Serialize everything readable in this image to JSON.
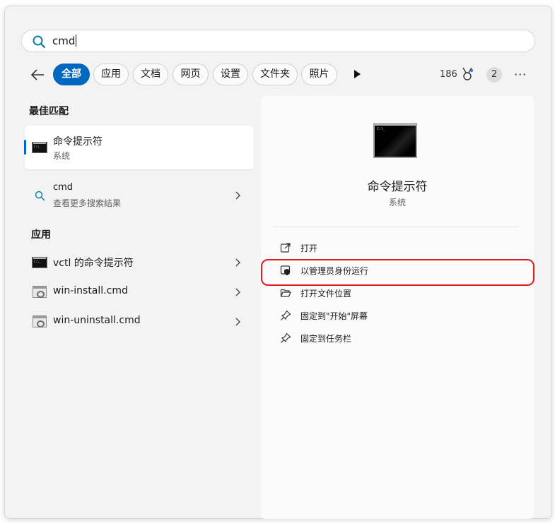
{
  "search": {
    "query": "cmd"
  },
  "filters": [
    {
      "label": "全部",
      "active": true
    },
    {
      "label": "应用"
    },
    {
      "label": "文档"
    },
    {
      "label": "网页"
    },
    {
      "label": "设置"
    },
    {
      "label": "文件夹"
    },
    {
      "label": "照片"
    }
  ],
  "header_right": {
    "points": "186",
    "avatar_letter": "2",
    "more": "···"
  },
  "best_match": {
    "section_title": "最佳匹配",
    "title": "命令提示符",
    "subtitle": "系统"
  },
  "web_search": {
    "title": "cmd",
    "subtitle": "查看更多搜索结果"
  },
  "apps": {
    "section_title": "应用",
    "items": [
      {
        "label": "vctl 的命令提示符",
        "icon": "cmd-icon"
      },
      {
        "label": "win-install.cmd",
        "icon": "script-icon"
      },
      {
        "label": "win-uninstall.cmd",
        "icon": "script-icon"
      }
    ]
  },
  "detail": {
    "title": "命令提示符",
    "subtitle": "系统",
    "actions": [
      {
        "label": "打开",
        "icon": "open-external-icon"
      },
      {
        "label": "以管理员身份运行",
        "icon": "shield-admin-icon"
      },
      {
        "label": "打开文件位置",
        "icon": "folder-open-icon"
      },
      {
        "label": "固定到\"开始\"屏幕",
        "icon": "pin-icon"
      },
      {
        "label": "固定到任务栏",
        "icon": "pin-icon"
      }
    ]
  },
  "colors": {
    "accent": "#0067c0",
    "highlight": "#e01b1b"
  }
}
